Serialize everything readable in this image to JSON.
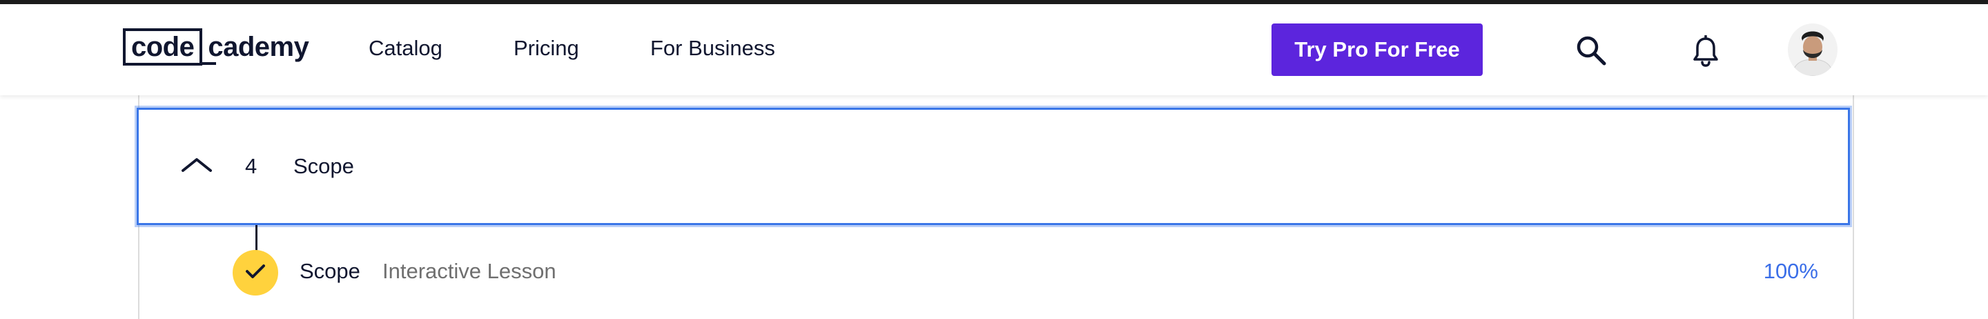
{
  "nav": {
    "logo_left": "code",
    "logo_right": "cademy",
    "links": [
      "Catalog",
      "Pricing",
      "For Business"
    ],
    "cta_label": "Try Pro For Free",
    "search_icon": "search-icon",
    "notifications_icon": "bell-icon",
    "avatar_icon": "user-avatar"
  },
  "module": {
    "number": "4",
    "title": "Scope",
    "expanded": true,
    "icon": "chevron-up-icon"
  },
  "lessons": [
    {
      "title": "Scope",
      "type": "Interactive Lesson",
      "progress": "100%",
      "completed": true,
      "icon": "check-icon"
    }
  ],
  "colors": {
    "brand_dark": "#10162f",
    "cta_purple": "#5c25dd",
    "focus_blue": "#3a76e8",
    "complete_yellow": "#ffd23d",
    "progress_blue": "#3a6ee8"
  }
}
